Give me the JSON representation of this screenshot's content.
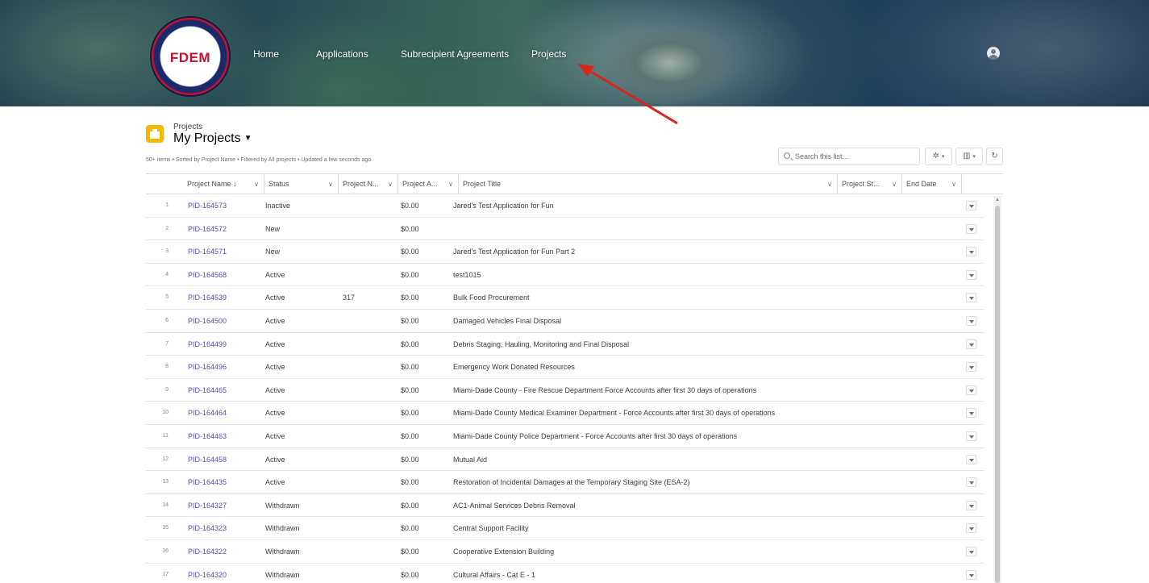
{
  "header": {
    "logo_text": "FDEM",
    "nav": [
      {
        "label": "Home"
      },
      {
        "label": "Applications"
      },
      {
        "label": "Subrecipient Agreements"
      },
      {
        "label": "Projects"
      }
    ]
  },
  "list": {
    "object_label": "Projects",
    "view_name": "My Projects",
    "meta": "50+ items • Sorted by Project Name • Filtered by All projects • Updated a few seconds ago",
    "search_placeholder": "Search this list..."
  },
  "table": {
    "columns": [
      {
        "label": "Project Name"
      },
      {
        "label": "Status"
      },
      {
        "label": "Project N..."
      },
      {
        "label": "Project A..."
      },
      {
        "label": "Project Title"
      },
      {
        "label": "Project St..."
      },
      {
        "label": "End Date"
      }
    ],
    "rows": [
      {
        "num": "1",
        "name": "PID-164573",
        "status": "Inactive",
        "project_number": "",
        "amount": "$0.00",
        "title": "Jared's Test Application for Fun"
      },
      {
        "num": "2",
        "name": "PID-164572",
        "status": "New",
        "project_number": "",
        "amount": "$0.00",
        "title": ""
      },
      {
        "num": "3",
        "name": "PID-164571",
        "status": "New",
        "project_number": "",
        "amount": "$0.00",
        "title": "Jared's Test Application for Fun Part 2"
      },
      {
        "num": "4",
        "name": "PID-164568",
        "status": "Active",
        "project_number": "",
        "amount": "$0.00",
        "title": "test1015"
      },
      {
        "num": "5",
        "name": "PID-164539",
        "status": "Active",
        "project_number": "317",
        "amount": "$0.00",
        "title": "Bulk Food Procurement"
      },
      {
        "num": "6",
        "name": "PID-164500",
        "status": "Active",
        "project_number": "",
        "amount": "$0.00",
        "title": "Damaged Vehicles Final Disposal"
      },
      {
        "num": "7",
        "name": "PID-164499",
        "status": "Active",
        "project_number": "",
        "amount": "$0.00",
        "title": "Debris Staging, Hauling, Monitoring and Final Disposal"
      },
      {
        "num": "8",
        "name": "PID-164496",
        "status": "Active",
        "project_number": "",
        "amount": "$0.00",
        "title": "Emergency Work Donated Resources"
      },
      {
        "num": "9",
        "name": "PID-164465",
        "status": "Active",
        "project_number": "",
        "amount": "$0.00",
        "title": "Miami-Dade County - Fire Rescue Department Force Accounts after first 30 days of operations"
      },
      {
        "num": "10",
        "name": "PID-164464",
        "status": "Active",
        "project_number": "",
        "amount": "$0.00",
        "title": "Miami-Dade County Medical Examiner Department - Force Accounts after first 30 days of operations"
      },
      {
        "num": "11",
        "name": "PID-164463",
        "status": "Active",
        "project_number": "",
        "amount": "$0.00",
        "title": "Miami-Dade County Police Department - Force Accounts after first 30 days of operations"
      },
      {
        "num": "12",
        "name": "PID-164458",
        "status": "Active",
        "project_number": "",
        "amount": "$0.00",
        "title": "Mutual Aid"
      },
      {
        "num": "13",
        "name": "PID-164435",
        "status": "Active",
        "project_number": "",
        "amount": "$0.00",
        "title": "Restoration of Incidental Damages at the Temporary Staging Site (ESA-2)"
      },
      {
        "num": "14",
        "name": "PID-164327",
        "status": "Withdrawn",
        "project_number": "",
        "amount": "$0.00",
        "title": "AC1-Animal Services Debris Removal"
      },
      {
        "num": "15",
        "name": "PID-164323",
        "status": "Withdrawn",
        "project_number": "",
        "amount": "$0.00",
        "title": "Central Support Facility"
      },
      {
        "num": "16",
        "name": "PID-164322",
        "status": "Withdrawn",
        "project_number": "",
        "amount": "$0.00",
        "title": "Cooperative Extension Building"
      },
      {
        "num": "17",
        "name": "PID-164320",
        "status": "Withdrawn",
        "project_number": "",
        "amount": "$0.00",
        "title": "Cultural Affairs - Cat E - 1"
      }
    ]
  },
  "colors": {
    "link": "#5a4fa8",
    "annotation_arrow": "#d9261c",
    "object_icon": "#f2b900"
  }
}
